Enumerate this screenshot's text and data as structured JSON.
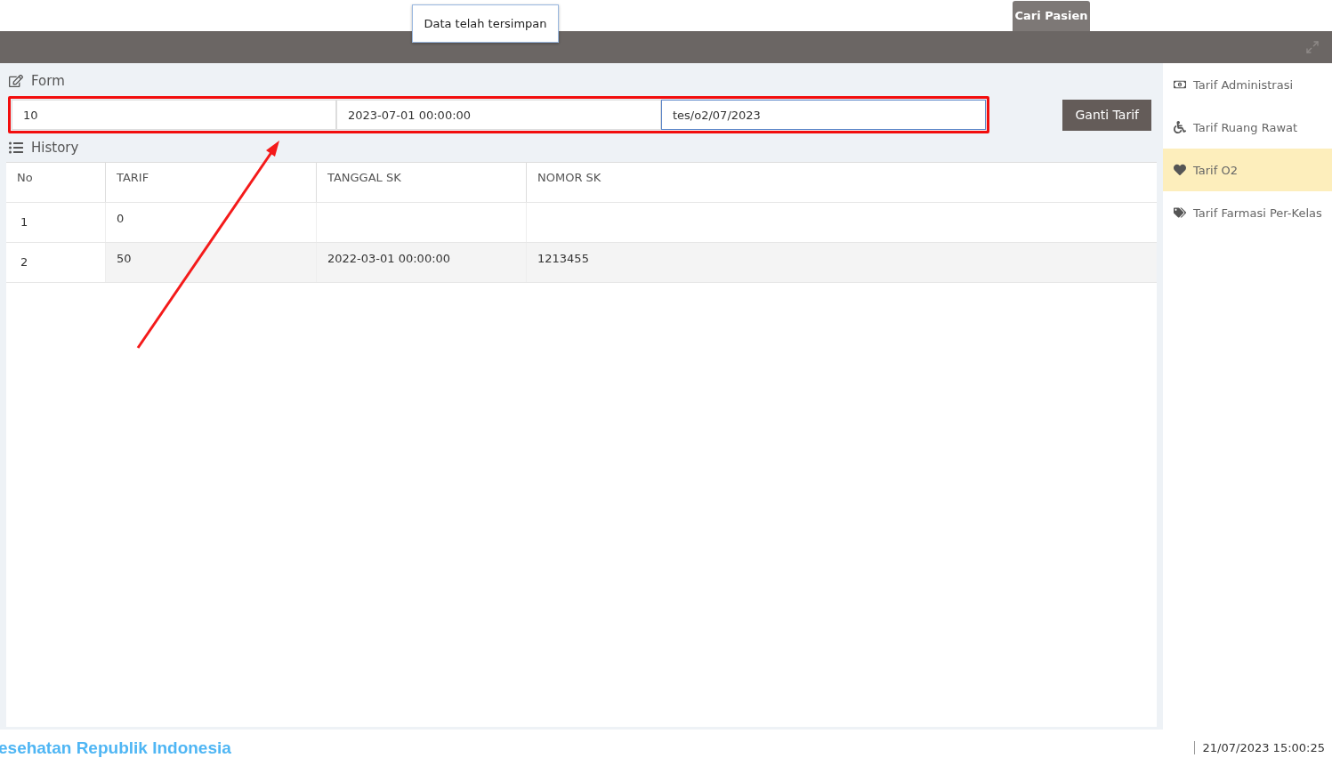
{
  "toast": {
    "message": "Data telah tersimpan"
  },
  "top_button": {
    "label": "Cari Pasien"
  },
  "form": {
    "title": "Form",
    "fields": [
      {
        "value": "10"
      },
      {
        "value": "2023-07-01 00:00:00"
      },
      {
        "value": "tes/o2/07/2023"
      }
    ],
    "button": "Ganti Tarif"
  },
  "history": {
    "title": "History",
    "columns": [
      "No",
      "TARIF",
      "TANGGAL SK",
      "NOMOR SK"
    ],
    "rows": [
      [
        "1",
        "0",
        "",
        ""
      ],
      [
        "2",
        "50",
        "2022-03-01 00:00:00",
        "1213455"
      ]
    ]
  },
  "sidebar": {
    "items": [
      {
        "label": "Tarif Administrasi",
        "selected": false
      },
      {
        "label": "Tarif Ruang Rawat",
        "selected": false
      },
      {
        "label": "Tarif O2",
        "selected": true
      },
      {
        "label": "Tarif Farmasi Per-Kelas",
        "selected": false
      }
    ]
  },
  "footer": {
    "brand": "esehatan Republik Indonesia",
    "datetime": "21/07/2023 15:00:25"
  }
}
